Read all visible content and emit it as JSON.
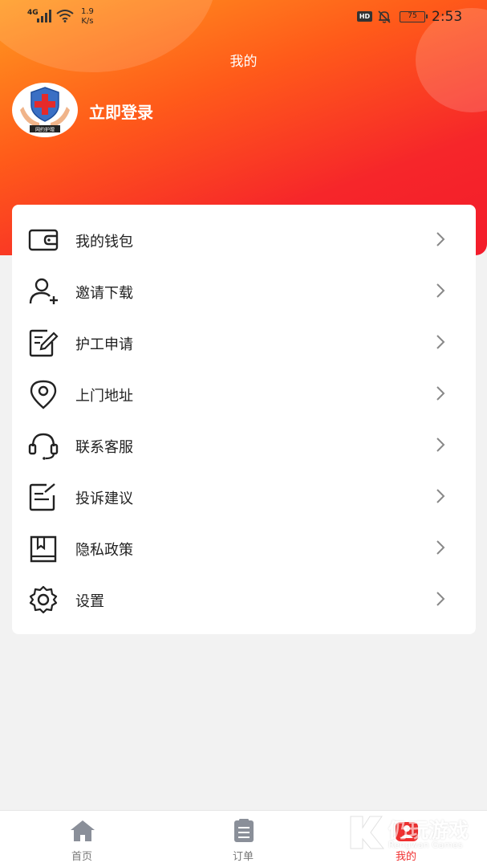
{
  "status_bar": {
    "network": "4G",
    "speed_value": "1.9",
    "speed_unit": "K/s",
    "hd": "HD",
    "battery": "75",
    "time": "2:53"
  },
  "header": {
    "title": "我的",
    "login_label": "立即登录",
    "avatar_text": "网约护理"
  },
  "menu": {
    "items": [
      {
        "label": "我的钱包",
        "icon": "wallet-icon"
      },
      {
        "label": "邀请下载",
        "icon": "add-user-icon"
      },
      {
        "label": "护工申请",
        "icon": "edit-form-icon"
      },
      {
        "label": "上门地址",
        "icon": "location-pin-icon"
      },
      {
        "label": "联系客服",
        "icon": "headset-icon"
      },
      {
        "label": "投诉建议",
        "icon": "feedback-icon"
      },
      {
        "label": "隐私政策",
        "icon": "book-icon"
      },
      {
        "label": "设置",
        "icon": "gear-icon"
      }
    ]
  },
  "tabbar": {
    "tabs": [
      {
        "label": "首页",
        "icon": "home-icon",
        "active": false
      },
      {
        "label": "订单",
        "icon": "clipboard-icon",
        "active": false
      },
      {
        "label": "我的",
        "icon": "profile-icon",
        "active": true
      }
    ]
  },
  "watermark": {
    "text": "仍玩游戏",
    "sub": "Rengwan Games"
  },
  "colors": {
    "accent": "#f31c2b",
    "gradient_start": "#ff9a1f",
    "active_tab": "#f03030"
  }
}
